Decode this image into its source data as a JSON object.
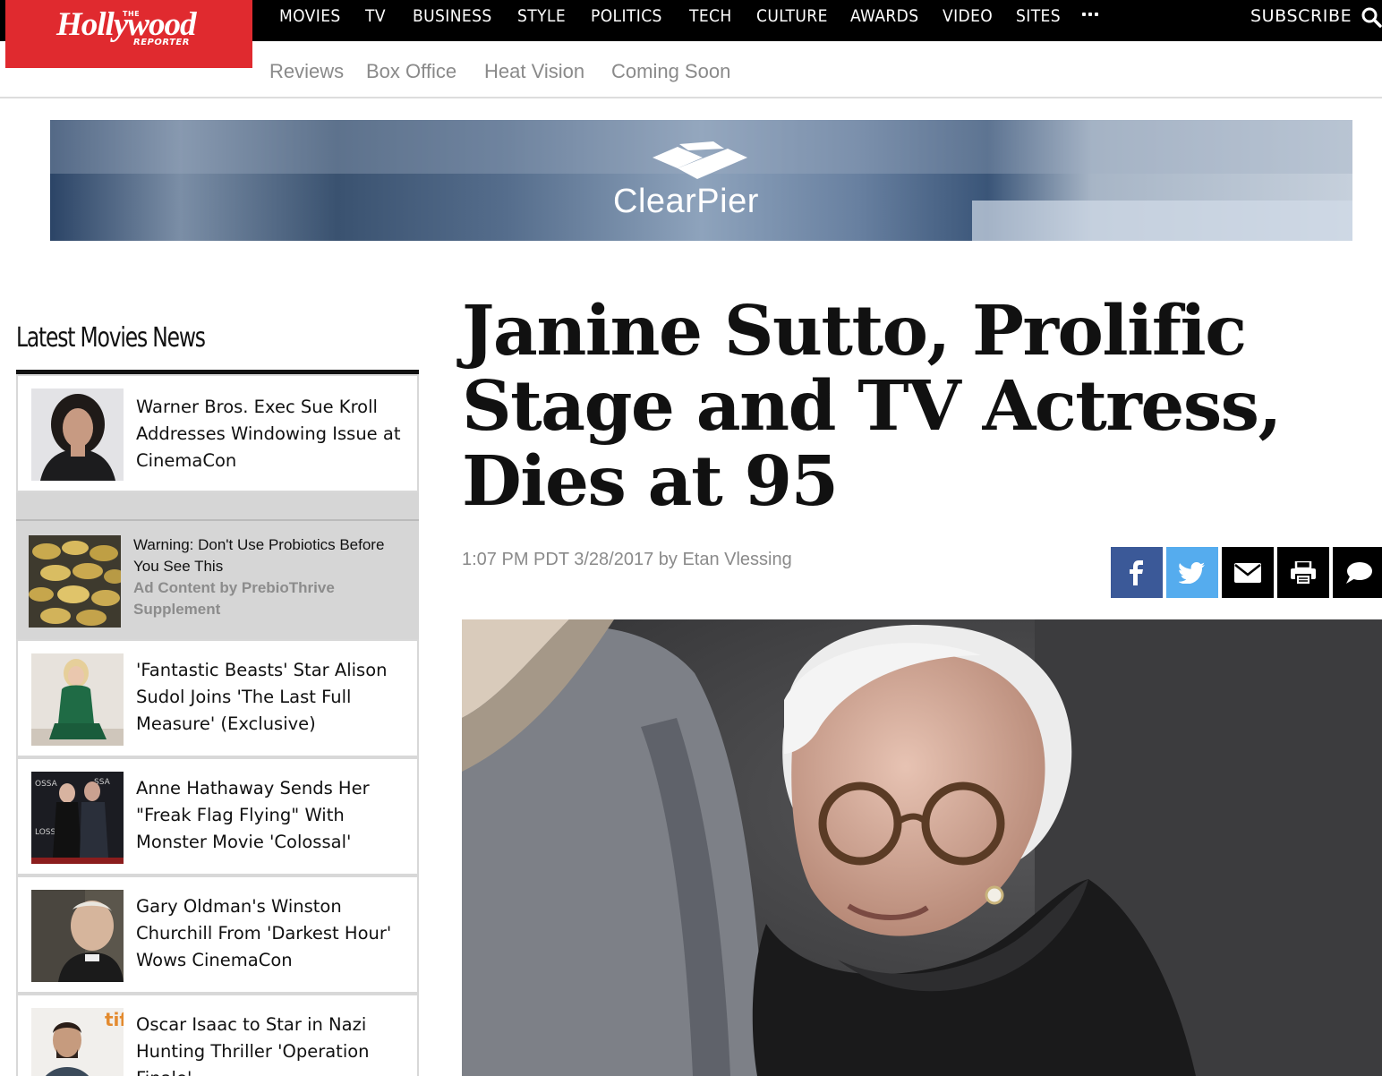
{
  "brand": {
    "the": "THE",
    "name": "Hollywood",
    "reporter": "REPORTER",
    "red": "#e02a2f"
  },
  "main_nav": {
    "items": [
      "MOVIES",
      "TV",
      "BUSINESS",
      "STYLE",
      "POLITICS",
      "TECH",
      "CULTURE",
      "AWARDS",
      "VIDEO",
      "SITES"
    ],
    "more_icon": "more-dots-icon",
    "subscribe": "SUBSCRIBE",
    "search_icon": "search-icon"
  },
  "sub_nav": {
    "items": [
      "Reviews",
      "Box Office",
      "Heat Vision",
      "Coming Soon"
    ]
  },
  "banner_ad": {
    "brand": "ClearPier"
  },
  "sidebar": {
    "title": "Latest Movies News",
    "items": [
      {
        "text": "Warner Bros. Exec Sue Kroll Addresses Windowing Issue at CinemaCon"
      },
      {
        "text": "'Fantastic Beasts' Star Alison Sudol Joins 'The Last Full Measure' (Exclusive)"
      },
      {
        "text": "Anne Hathaway Sends Her \"Freak Flag Flying\" With Monster Movie 'Colossal'"
      },
      {
        "text": "Gary Oldman's Winston Churchill From 'Darkest Hour' Wows CinemaCon"
      },
      {
        "text": "Oscar Isaac to Star in Nazi Hunting Thriller 'Operation Finale'"
      }
    ],
    "ad": {
      "title": "Warning: Don't Use Probiotics Before You See This",
      "by": "Ad Content by PrebioThrive Supplement"
    }
  },
  "article": {
    "headline": "Janine Sutto, Prolific Stage and TV Actress, Dies at 95",
    "byline": "1:07 PM PDT 3/28/2017 by Etan Vlessing",
    "share": [
      {
        "icon": "facebook-icon",
        "color": "#3b5998"
      },
      {
        "icon": "twitter-icon",
        "color": "#55acee"
      },
      {
        "icon": "email-icon",
        "color": "#000000"
      },
      {
        "icon": "print-icon",
        "color": "#000000"
      },
      {
        "icon": "comment-icon",
        "color": "#000000"
      }
    ]
  }
}
